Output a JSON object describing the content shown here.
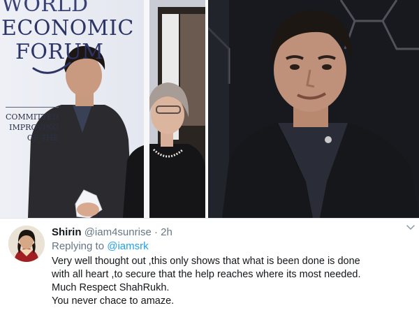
{
  "photo_left": {
    "logo_lines": [
      "WORLD",
      "ECONOMIC",
      "FORUM"
    ],
    "banner_lines": [
      "COMMITTED",
      "IMPROVING",
      "OF THE"
    ]
  },
  "tweet": {
    "display_name": "Shirin",
    "handle": "@iam4sunrise",
    "separator": "·",
    "timestamp": "2h",
    "replying_to_label": "Replying to",
    "replying_to_handle": "@iamsrk",
    "text_lines": [
      "Very well thought out ,this only shows that what is been done is done",
      "with all heart ,to secure that the help reaches where its most needed.",
      "Much Respect ShahRukh.",
      "You never chace to amaze."
    ]
  },
  "colors": {
    "link": "#1da1f2",
    "secondary_text": "#657786",
    "primary_text": "#14171a",
    "logo_blue": "#2c3566"
  },
  "icons": {
    "menu": "chevron-down-icon"
  }
}
